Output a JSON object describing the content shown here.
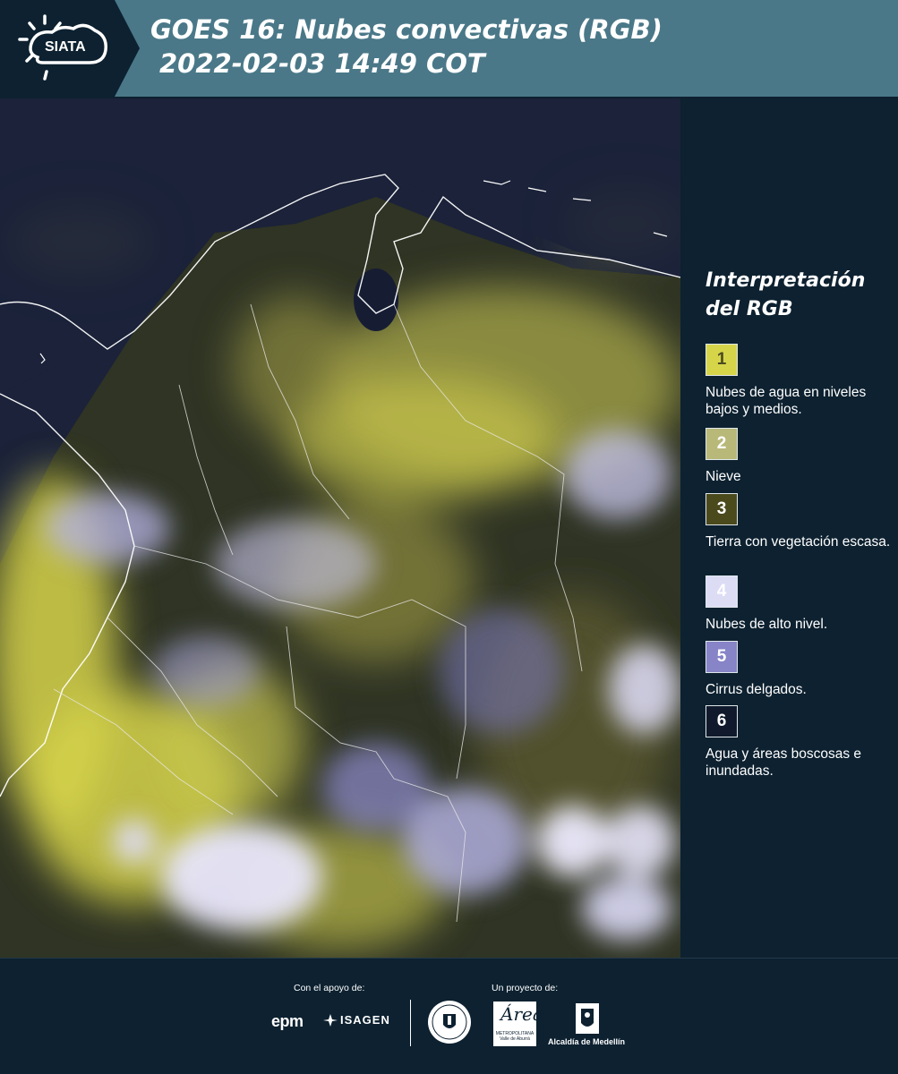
{
  "header": {
    "logo_text": "SIATA",
    "title_line1": "GOES 16: Nubes convectivas (RGB)",
    "title_line2": "2022-02-03 14:49 COT"
  },
  "map": {
    "image_description_icon": "satellite-rgb-map",
    "background_color": "#1a2238",
    "border_color": "#ffffff"
  },
  "legend": {
    "title_line1": "Interpretación",
    "title_line2": "del RGB",
    "items": [
      {
        "number": "1",
        "label": "Nubes de agua en niveles bajos y medios.",
        "color": "#d6d54a",
        "text_color": "#4a4a20"
      },
      {
        "number": "2",
        "label": "Nieve",
        "color": "#b8b879",
        "text_color": "#ffffff"
      },
      {
        "number": "3",
        "label": "Tierra con vegetación escasa.",
        "color": "#4b4a1c",
        "text_color": "#ffffff"
      },
      {
        "number": "4",
        "label": "Nubes de alto nivel.",
        "color": "#dcdcf5",
        "text_color": "#ffffff"
      },
      {
        "number": "5",
        "label": "Cirrus delgados.",
        "color": "#8784c8",
        "text_color": "#ffffff"
      },
      {
        "number": "6",
        "label": "Agua y áreas boscosas e inundadas.",
        "color": "#101a2c",
        "text_color": "#ffffff"
      }
    ]
  },
  "footer": {
    "support_label": "Con el apoyo de:",
    "project_label": "Un proyecto de:",
    "epm": "epm",
    "isagen": "ISAGEN",
    "area_logo": "Área",
    "area_sub": "METROPOLITANA Valle de Aburrá",
    "alcaldia": "Alcaldía de Medellín"
  }
}
